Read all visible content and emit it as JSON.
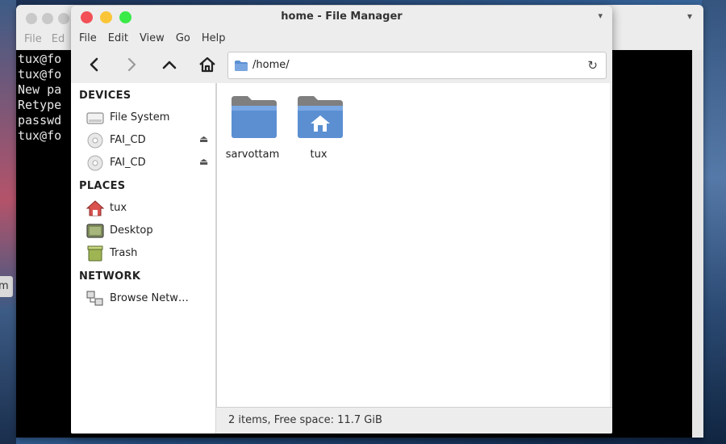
{
  "desktop": {
    "side_label": "m"
  },
  "terminal": {
    "menu": [
      "File",
      "Ed"
    ],
    "lines": [
      "tux@fo",
      "tux@fo",
      "New pa",
      "Retype",
      "passwd",
      "tux@fo"
    ]
  },
  "file_manager": {
    "title": "home - File Manager",
    "menu": {
      "file": "File",
      "edit": "Edit",
      "view": "View",
      "go": "Go",
      "help": "Help"
    },
    "path": "/home/",
    "sidebar": {
      "devices_heading": "DEVICES",
      "devices": [
        {
          "label": "File System",
          "icon": "drive-icon"
        },
        {
          "label": "FAI_CD",
          "icon": "cd-icon",
          "eject": true
        },
        {
          "label": "FAI_CD",
          "icon": "cd-icon",
          "eject": true
        }
      ],
      "places_heading": "PLACES",
      "places": [
        {
          "label": "tux",
          "icon": "home-icon"
        },
        {
          "label": "Desktop",
          "icon": "desktop-icon"
        },
        {
          "label": "Trash",
          "icon": "trash-icon"
        }
      ],
      "network_heading": "NETWORK",
      "network": [
        {
          "label": "Browse Netw…",
          "icon": "network-icon"
        }
      ]
    },
    "files": [
      {
        "name": "sarvottam",
        "icon": "folder-icon"
      },
      {
        "name": "tux",
        "icon": "home-folder-icon"
      }
    ],
    "status": "2 items, Free space: 11.7 GiB",
    "colors": {
      "close": "#f25056",
      "minimize": "#fac536",
      "maximize": "#39ea49",
      "folder": "#5b8fd2"
    }
  }
}
